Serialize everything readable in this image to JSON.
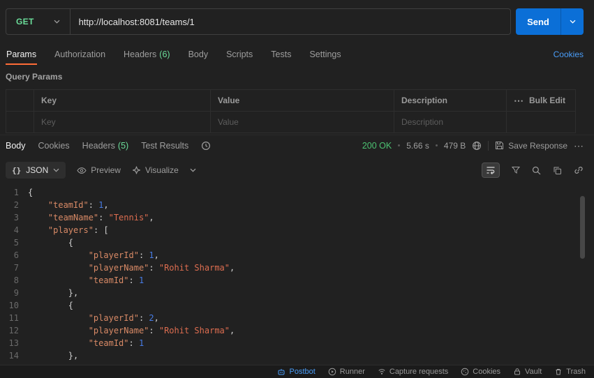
{
  "request": {
    "method": "GET",
    "url": "http://localhost:8081/teams/1",
    "send_label": "Send"
  },
  "request_tabs": {
    "items": [
      {
        "label": "Params"
      },
      {
        "label": "Authorization"
      },
      {
        "label": "Headers",
        "count": "(6)"
      },
      {
        "label": "Body"
      },
      {
        "label": "Scripts"
      },
      {
        "label": "Tests"
      },
      {
        "label": "Settings"
      }
    ],
    "cookies_link": "Cookies"
  },
  "query_params": {
    "title": "Query Params",
    "columns": {
      "key": "Key",
      "value": "Value",
      "description": "Description"
    },
    "bulk_edit_label": "Bulk Edit",
    "placeholders": {
      "key": "Key",
      "value": "Value",
      "description": "Description"
    }
  },
  "response": {
    "tabs": [
      {
        "label": "Body"
      },
      {
        "label": "Cookies"
      },
      {
        "label": "Headers",
        "count": "(5)"
      },
      {
        "label": "Test Results"
      }
    ],
    "status": "200 OK",
    "time": "5.66 s",
    "size": "479 B",
    "save_label": "Save Response"
  },
  "viewer": {
    "format_icon": "{}",
    "format": "JSON",
    "preview_label": "Preview",
    "visualize_label": "Visualize"
  },
  "code": {
    "lines": [
      {
        "n": "1",
        "tokens": [
          [
            "p",
            "{"
          ]
        ]
      },
      {
        "n": "2",
        "tokens": [
          [
            "w",
            "    "
          ],
          [
            "k",
            "\"teamId\""
          ],
          [
            "p",
            ": "
          ],
          [
            "num",
            "1"
          ],
          [
            "p",
            ","
          ]
        ]
      },
      {
        "n": "3",
        "tokens": [
          [
            "w",
            "    "
          ],
          [
            "k",
            "\"teamName\""
          ],
          [
            "p",
            ": "
          ],
          [
            "s",
            "\"Tennis\""
          ],
          [
            "p",
            ","
          ]
        ]
      },
      {
        "n": "4",
        "tokens": [
          [
            "w",
            "    "
          ],
          [
            "k",
            "\"players\""
          ],
          [
            "p",
            ": ["
          ]
        ]
      },
      {
        "n": "5",
        "tokens": [
          [
            "w",
            "        "
          ],
          [
            "p",
            "{"
          ]
        ]
      },
      {
        "n": "6",
        "tokens": [
          [
            "w",
            "            "
          ],
          [
            "k",
            "\"playerId\""
          ],
          [
            "p",
            ": "
          ],
          [
            "num",
            "1"
          ],
          [
            "p",
            ","
          ]
        ]
      },
      {
        "n": "7",
        "tokens": [
          [
            "w",
            "            "
          ],
          [
            "k",
            "\"playerName\""
          ],
          [
            "p",
            ": "
          ],
          [
            "s",
            "\"Rohit Sharma\""
          ],
          [
            "p",
            ","
          ]
        ]
      },
      {
        "n": "8",
        "tokens": [
          [
            "w",
            "            "
          ],
          [
            "k",
            "\"teamId\""
          ],
          [
            "p",
            ": "
          ],
          [
            "num",
            "1"
          ]
        ]
      },
      {
        "n": "9",
        "tokens": [
          [
            "w",
            "        "
          ],
          [
            "p",
            "},"
          ]
        ]
      },
      {
        "n": "10",
        "tokens": [
          [
            "w",
            "        "
          ],
          [
            "p",
            "{"
          ]
        ]
      },
      {
        "n": "11",
        "tokens": [
          [
            "w",
            "            "
          ],
          [
            "k",
            "\"playerId\""
          ],
          [
            "p",
            ": "
          ],
          [
            "num",
            "2"
          ],
          [
            "p",
            ","
          ]
        ]
      },
      {
        "n": "12",
        "tokens": [
          [
            "w",
            "            "
          ],
          [
            "k",
            "\"playerName\""
          ],
          [
            "p",
            ": "
          ],
          [
            "s",
            "\"Rohit Sharma\""
          ],
          [
            "p",
            ","
          ]
        ]
      },
      {
        "n": "13",
        "tokens": [
          [
            "w",
            "            "
          ],
          [
            "k",
            "\"teamId\""
          ],
          [
            "p",
            ": "
          ],
          [
            "num",
            "1"
          ]
        ]
      },
      {
        "n": "14",
        "tokens": [
          [
            "w",
            "        "
          ],
          [
            "p",
            "},"
          ]
        ]
      }
    ]
  },
  "footer": {
    "items": [
      {
        "label": "Postbot"
      },
      {
        "label": "Runner"
      },
      {
        "label": "Capture requests"
      },
      {
        "label": "Cookies"
      },
      {
        "label": "Vault"
      },
      {
        "label": "Trash"
      }
    ]
  },
  "icons": {
    "more": "⋯"
  },
  "colors": {
    "method_get": "#6bdd9a",
    "send_button": "#0b6fd7",
    "active_tab_underline": "#ff6c37",
    "status_ok": "#4cc272",
    "link_blue": "#4a9df8",
    "json_key": "#d98a66",
    "json_string": "#dd6d50",
    "json_number": "#477ce6"
  }
}
